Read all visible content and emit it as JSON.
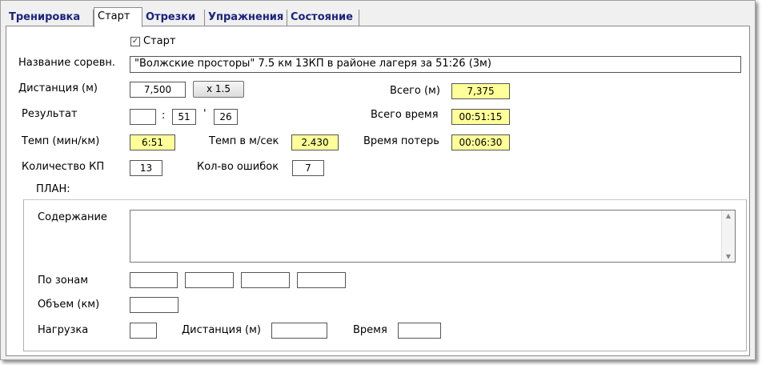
{
  "tabs": [
    {
      "label": "Тренировка",
      "active": false
    },
    {
      "label": "Старт",
      "active": true
    },
    {
      "label": "Отрезки",
      "active": false
    },
    {
      "label": "Упражнения",
      "active": false
    },
    {
      "label": "Состояние",
      "active": false
    }
  ],
  "start": {
    "checkbox_label": "Старт",
    "checked": true,
    "competition_label": "Название соревн.",
    "competition_value": "\"Волжские просторы\" 7.5 км 13КП в районе лагеря за 51:26 (3м)",
    "distance_label": "Дистанция (м)",
    "distance_value": "7,500",
    "multiplier_label": "x 1.5",
    "total_label": "Всего (м)",
    "total_value": "7,375",
    "result_label": "Результат",
    "result_hours": "",
    "result_sep1": ":",
    "result_minutes": "51",
    "result_sep2": "'",
    "result_seconds": "26",
    "total_time_label": "Всего время",
    "total_time_value": "00:51:15",
    "pace_label": "Темп (мин/км)",
    "pace_value": "6:51",
    "speed_label": "Темп в м/сек",
    "speed_value": "2.430",
    "lost_time_label": "Время потерь",
    "lost_time_value": "00:06:30",
    "cp_count_label": "Количество КП",
    "cp_count_value": "13",
    "errors_label": "Кол-во ошибок",
    "errors_value": "7"
  },
  "plan": {
    "title": "ПЛАН:",
    "content_label": "Содержание",
    "content_value": "",
    "zones_label": "По зонам",
    "zones": [
      "",
      "",
      "",
      ""
    ],
    "volume_label": "Объем (км)",
    "volume_value": "",
    "load_label": "Нагрузка",
    "load_value": "",
    "distance_label": "Дистанция (м)",
    "distance_value": "",
    "time_label": "Время",
    "time_value": ""
  },
  "icons": {
    "check": "✓",
    "scroll_up": "▲",
    "scroll_down": "▼"
  }
}
